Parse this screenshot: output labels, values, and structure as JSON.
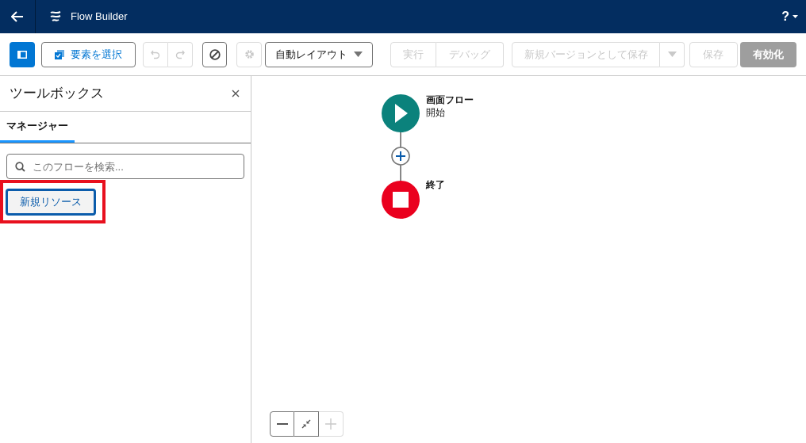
{
  "header": {
    "title": "Flow Builder",
    "help": "?"
  },
  "toolbar": {
    "panel_toggle": {
      "selected": true
    },
    "select_elements": {
      "label": "要素を選択"
    },
    "undo": {
      "disabled": true
    },
    "redo": {
      "disabled": true
    },
    "settings": {
      "disabled": true
    },
    "layout": {
      "value": "自動レイアウト"
    },
    "run": {
      "label": "実行",
      "disabled": true
    },
    "debug": {
      "label": "デバッグ",
      "disabled": true
    },
    "save_as_new_version": {
      "label": "新規バージョンとして保存",
      "disabled": true
    },
    "save": {
      "label": "保存",
      "disabled": true
    },
    "activate": {
      "label": "有効化",
      "disabled": true
    }
  },
  "toolbox": {
    "title": "ツールボックス",
    "tabs": [
      {
        "label": "マネージャー",
        "selected": true
      }
    ],
    "search": {
      "placeholder": "このフローを検索..."
    },
    "new_resource": {
      "label": "新規リソース",
      "highlighted": true
    }
  },
  "canvas": {
    "start": {
      "title": "画面フロー",
      "subtitle": "開始"
    },
    "end": {
      "title": "終了"
    },
    "zoom_controls": [
      {
        "kind": "zoom-out",
        "disabled": false
      },
      {
        "kind": "fit",
        "disabled": false
      },
      {
        "kind": "zoom-in",
        "disabled": true
      }
    ]
  }
}
